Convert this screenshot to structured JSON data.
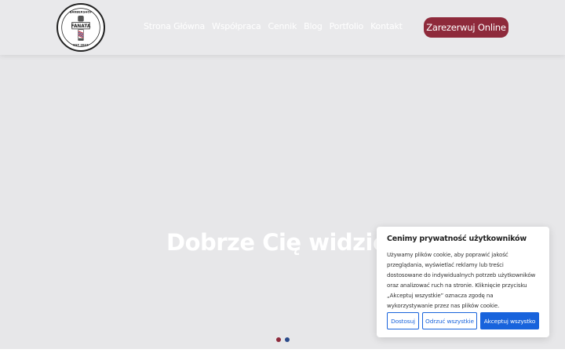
{
  "header": {
    "logo": {
      "top_text": "BARBERSHOP",
      "name": "FANATA",
      "bottom_text": "EST 2023"
    },
    "nav": [
      {
        "label": "Strona Główna"
      },
      {
        "label": "Współpraca"
      },
      {
        "label": "Cennik"
      },
      {
        "label": "Blog"
      },
      {
        "label": "Portfolio"
      },
      {
        "label": "Kontakt"
      }
    ],
    "cta_label": "Zarezerwuj Online"
  },
  "hero": {
    "title": "Dobrze Cię widzie",
    "slider_dots": 2
  },
  "cookie_banner": {
    "title": "Cenimy prywatność użytkowników",
    "text": "Używamy plików cookie, aby poprawić jakość przeglądania, wyświetlać reklamy lub treści dostosowane do indywidualnych potrzeb użytkowników oraz analizować ruch na stronie. Kliknięcie przycisku „Akceptuj wszystkie” oznacza zgodę na wykorzystywanie przez nas plików cookie.",
    "buttons": {
      "customize": "Dostosuj",
      "reject": "Odrzuć wszystkie",
      "accept": "Akceptuj wszystko"
    }
  },
  "colors": {
    "brand": "#8e2a3b",
    "cookie_accent": "#1863dc",
    "header_bg": "#e9e9eb"
  }
}
